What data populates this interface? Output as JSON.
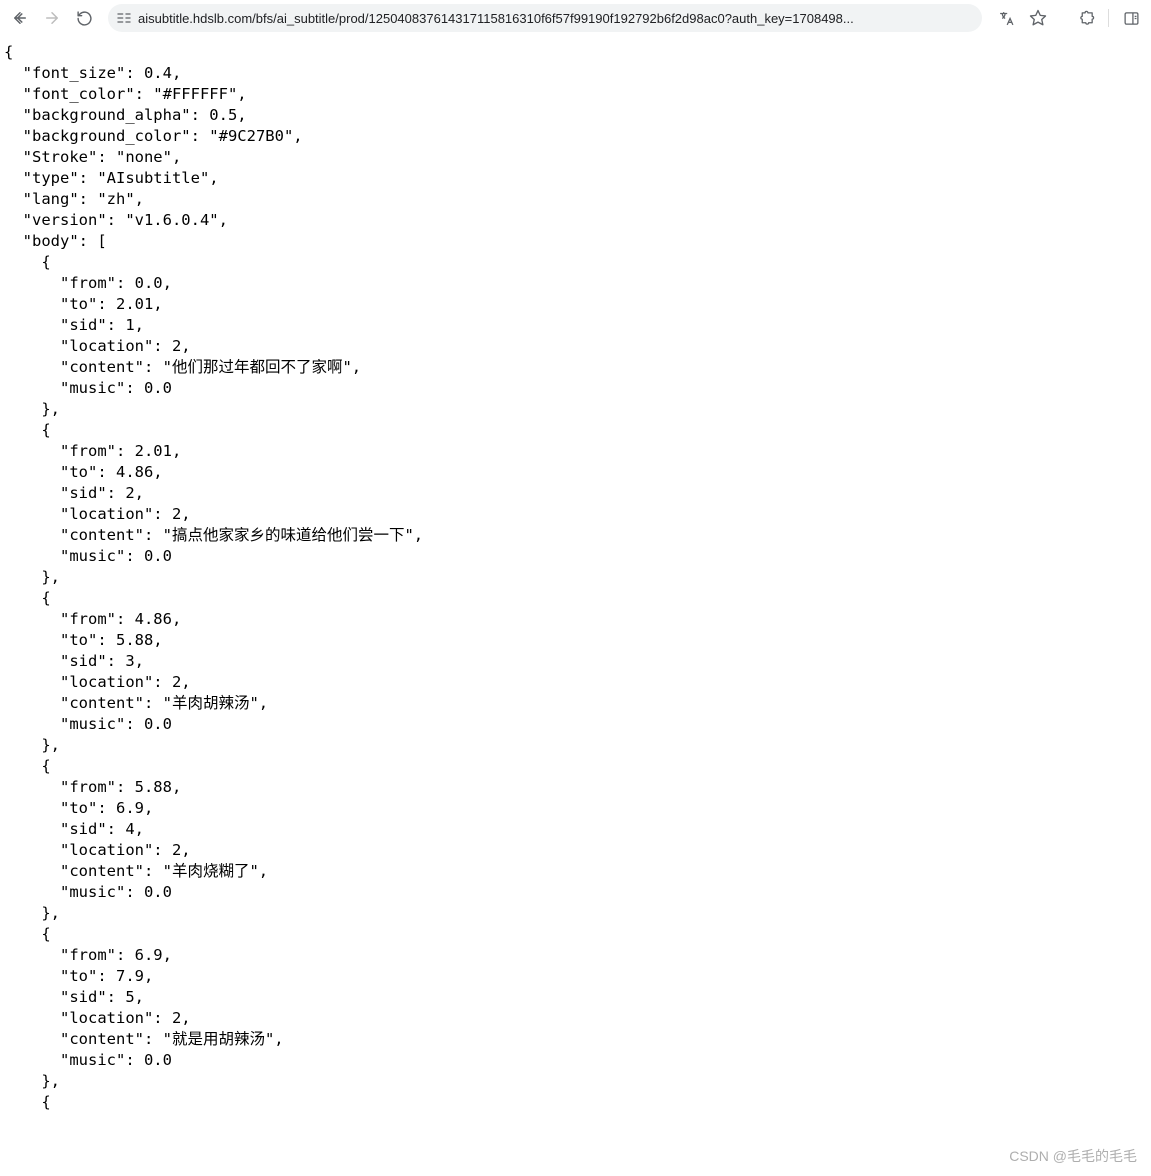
{
  "toolbar": {
    "url": "aisubtitle.hdslb.com/bfs/ai_subtitle/prod/12504083761431711581​6310f6f57f99190f192792b6f2d98ac0?auth_key=1708498..."
  },
  "json": {
    "font_size": 0.4,
    "font_color": "#FFFFFF",
    "background_alpha": 0.5,
    "background_color": "#9C27B0",
    "Stroke": "none",
    "type": "AIsubtitle",
    "lang": "zh",
    "version": "v1.6.0.4",
    "body": [
      {
        "from": 0.0,
        "to": 2.01,
        "sid": 1,
        "location": 2,
        "content": "他们那过年都回不了家啊",
        "music": 0.0
      },
      {
        "from": 2.01,
        "to": 4.86,
        "sid": 2,
        "location": 2,
        "content": "搞点他家家乡的味道给他们尝一下",
        "music": 0.0
      },
      {
        "from": 4.86,
        "to": 5.88,
        "sid": 3,
        "location": 2,
        "content": "羊肉胡辣汤",
        "music": 0.0
      },
      {
        "from": 5.88,
        "to": 6.9,
        "sid": 4,
        "location": 2,
        "content": "羊肉烧糊了",
        "music": 0.0
      },
      {
        "from": 6.9,
        "to": 7.9,
        "sid": 5,
        "location": 2,
        "content": "就是用胡辣汤",
        "music": 0.0
      }
    ]
  },
  "watermark": "CSDN @毛毛的毛毛"
}
